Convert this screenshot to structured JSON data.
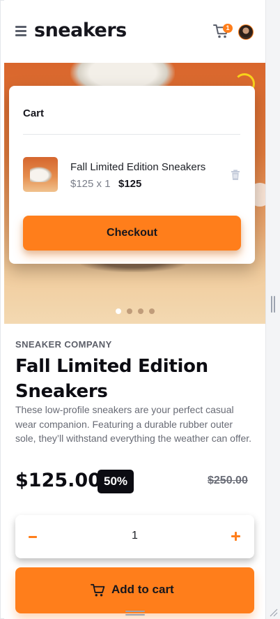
{
  "header": {
    "logo": "sneakers",
    "cart_count": "1"
  },
  "hero": {
    "slides": 4,
    "active_slide": 1
  },
  "cart": {
    "title": "Cart",
    "item": {
      "name": "Fall Limited Edition Sneakers",
      "unit_price_qty": "$125 x 1",
      "total": "$125"
    },
    "checkout_label": "Checkout"
  },
  "product": {
    "company": "SNEAKER COMPANY",
    "title": "Fall Limited Edition Sneakers",
    "description": "These low-profile sneakers are your perfect casual wear companion. Featuring a durable rubber outer sole, they’ll withstand everything the weather can offer.",
    "price": "$125.00",
    "discount": "50%",
    "original_price": "$250.00"
  },
  "quantity": {
    "minus_label": "−",
    "value": "1",
    "plus_label": "+"
  },
  "add_to_cart": {
    "label": "Add to cart"
  },
  "colors": {
    "accent": "#ff7e1b",
    "text_dark": "#0c0c12",
    "text_muted": "#686b75"
  },
  "icons": [
    "menu-icon",
    "cart-icon",
    "avatar",
    "trash-icon",
    "minus-icon",
    "plus-icon",
    "cart-icon"
  ]
}
